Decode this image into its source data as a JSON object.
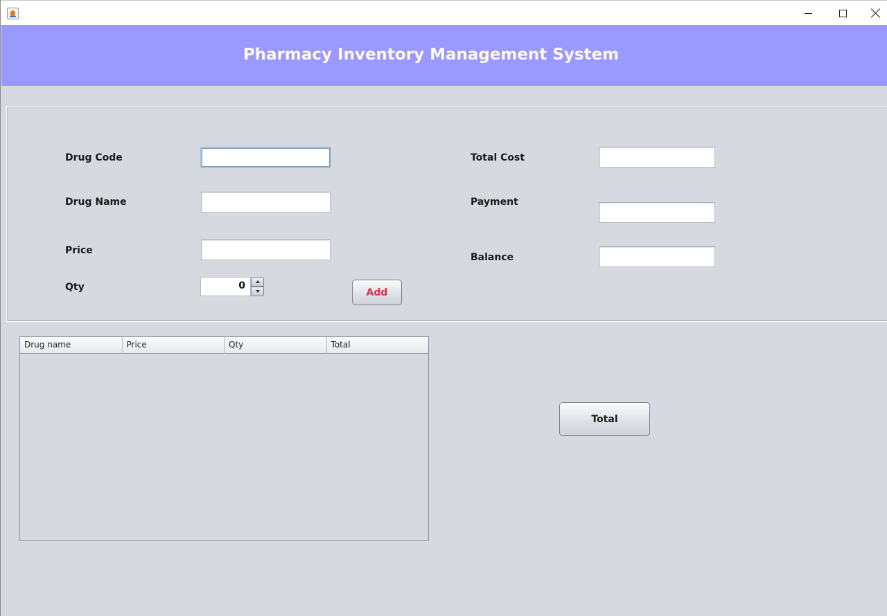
{
  "window": {
    "app_icon": "java-coffee-cup-icon",
    "controls": [
      "minimize-icon",
      "maximize-icon",
      "close-icon"
    ]
  },
  "header": {
    "title": "Pharmacy Inventory Management System",
    "background": "#9999ff",
    "title_color": "#fff9e6"
  },
  "form": {
    "drug_code": {
      "label": "Drug Code",
      "value": ""
    },
    "drug_name": {
      "label": "Drug Name",
      "value": ""
    },
    "price": {
      "label": "Price",
      "value": ""
    },
    "qty": {
      "label": "Qty",
      "value": "0"
    },
    "add_button": "Add",
    "total_cost": {
      "label": "Total Cost",
      "value": ""
    },
    "payment": {
      "label": "Payment",
      "value": ""
    },
    "balance": {
      "label": "Balance",
      "value": ""
    }
  },
  "table": {
    "columns": [
      "Drug name",
      "Price",
      "Qty",
      "Total"
    ],
    "rows": []
  },
  "total_button": "Total",
  "colors": {
    "background": "#d6d9e0",
    "add_text": "#e0284a"
  }
}
